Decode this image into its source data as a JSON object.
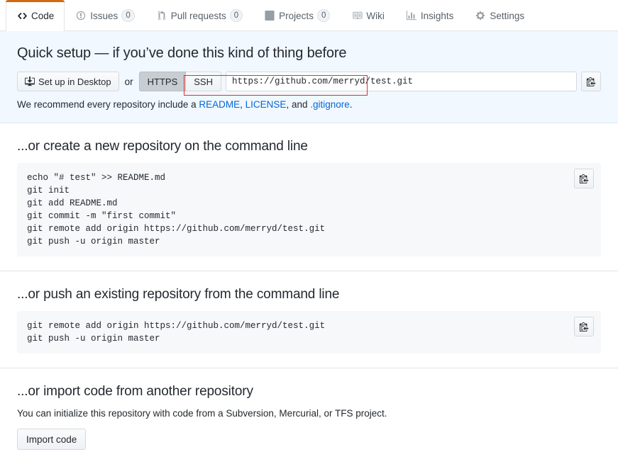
{
  "tabs": [
    {
      "label": "Code",
      "icon": "code-icon",
      "count": null,
      "selected": true
    },
    {
      "label": "Issues",
      "icon": "issue-opened-icon",
      "count": "0",
      "selected": false
    },
    {
      "label": "Pull requests",
      "icon": "git-pull-request-icon",
      "count": "0",
      "selected": false
    },
    {
      "label": "Projects",
      "icon": "project-icon",
      "count": "0",
      "selected": false
    },
    {
      "label": "Wiki",
      "icon": "book-icon",
      "count": null,
      "selected": false
    },
    {
      "label": "Insights",
      "icon": "graph-icon",
      "count": null,
      "selected": false
    },
    {
      "label": "Settings",
      "icon": "gear-icon",
      "count": null,
      "selected": false
    }
  ],
  "quick_setup": {
    "heading": "Quick setup — if you’ve done this kind of thing before",
    "desktop_button": "Set up in Desktop",
    "or_label": "or",
    "protocols": [
      {
        "label": "HTTPS",
        "active": true
      },
      {
        "label": "SSH",
        "active": false
      }
    ],
    "clone_url": "https://github.com/merryd/test.git",
    "copy_icon": "clipboard-icon",
    "recommend_prefix": "We recommend every repository include a ",
    "recommend_links": [
      "README",
      "LICENSE",
      ".gitignore"
    ],
    "recommend_sep": ", ",
    "recommend_and": ", and ",
    "recommend_suffix": ".",
    "background_color": "#f1f8ff"
  },
  "create_section": {
    "heading": "...or create a new repository on the command line",
    "commands": "echo \"# test\" >> README.md\ngit init\ngit add README.md\ngit commit -m \"first commit\"\ngit remote add origin https://github.com/merryd/test.git\ngit push -u origin master",
    "copy_icon": "clipboard-icon"
  },
  "push_section": {
    "heading": "...or push an existing repository from the command line",
    "commands": "git remote add origin https://github.com/merryd/test.git\ngit push -u origin master",
    "copy_icon": "clipboard-icon"
  },
  "import_section": {
    "heading": "...or import code from another repository",
    "description": "You can initialize this repository with code from a Subversion, Mercurial, or TFS project.",
    "button_label": "Import code"
  },
  "colors": {
    "accent_orange": "#d26911",
    "link_blue": "#0366d6",
    "annotation_red": "#e03030",
    "code_bg": "#f6f8fa"
  }
}
